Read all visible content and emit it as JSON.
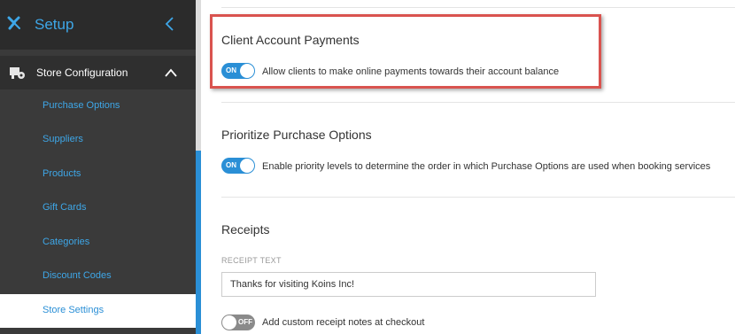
{
  "sidebar": {
    "title": "Setup",
    "section": {
      "label": "Store Configuration"
    },
    "items": [
      {
        "label": "Purchase Options"
      },
      {
        "label": "Suppliers"
      },
      {
        "label": "Products"
      },
      {
        "label": "Gift Cards"
      },
      {
        "label": "Categories"
      },
      {
        "label": "Discount Codes"
      },
      {
        "label": "Store Settings",
        "active": true
      }
    ]
  },
  "main": {
    "client_payments": {
      "heading": "Client Account Payments",
      "toggle_state": "ON",
      "description": "Allow clients to make online payments towards their account balance"
    },
    "priority": {
      "heading": "Prioritize Purchase Options",
      "toggle_state": "ON",
      "description": "Enable priority levels to determine the order in which Purchase Options are used when booking services"
    },
    "receipts": {
      "heading": "Receipts",
      "field_label": "RECEIPT TEXT",
      "field_value": "Thanks for visiting Koins Inc!",
      "notes_toggle_state": "OFF",
      "notes_description": "Add custom receipt notes at checkout"
    }
  },
  "colors": {
    "accent": "#2a8fd6",
    "sidebar_bg": "#3a3a3a",
    "highlight": "#d9534f"
  }
}
